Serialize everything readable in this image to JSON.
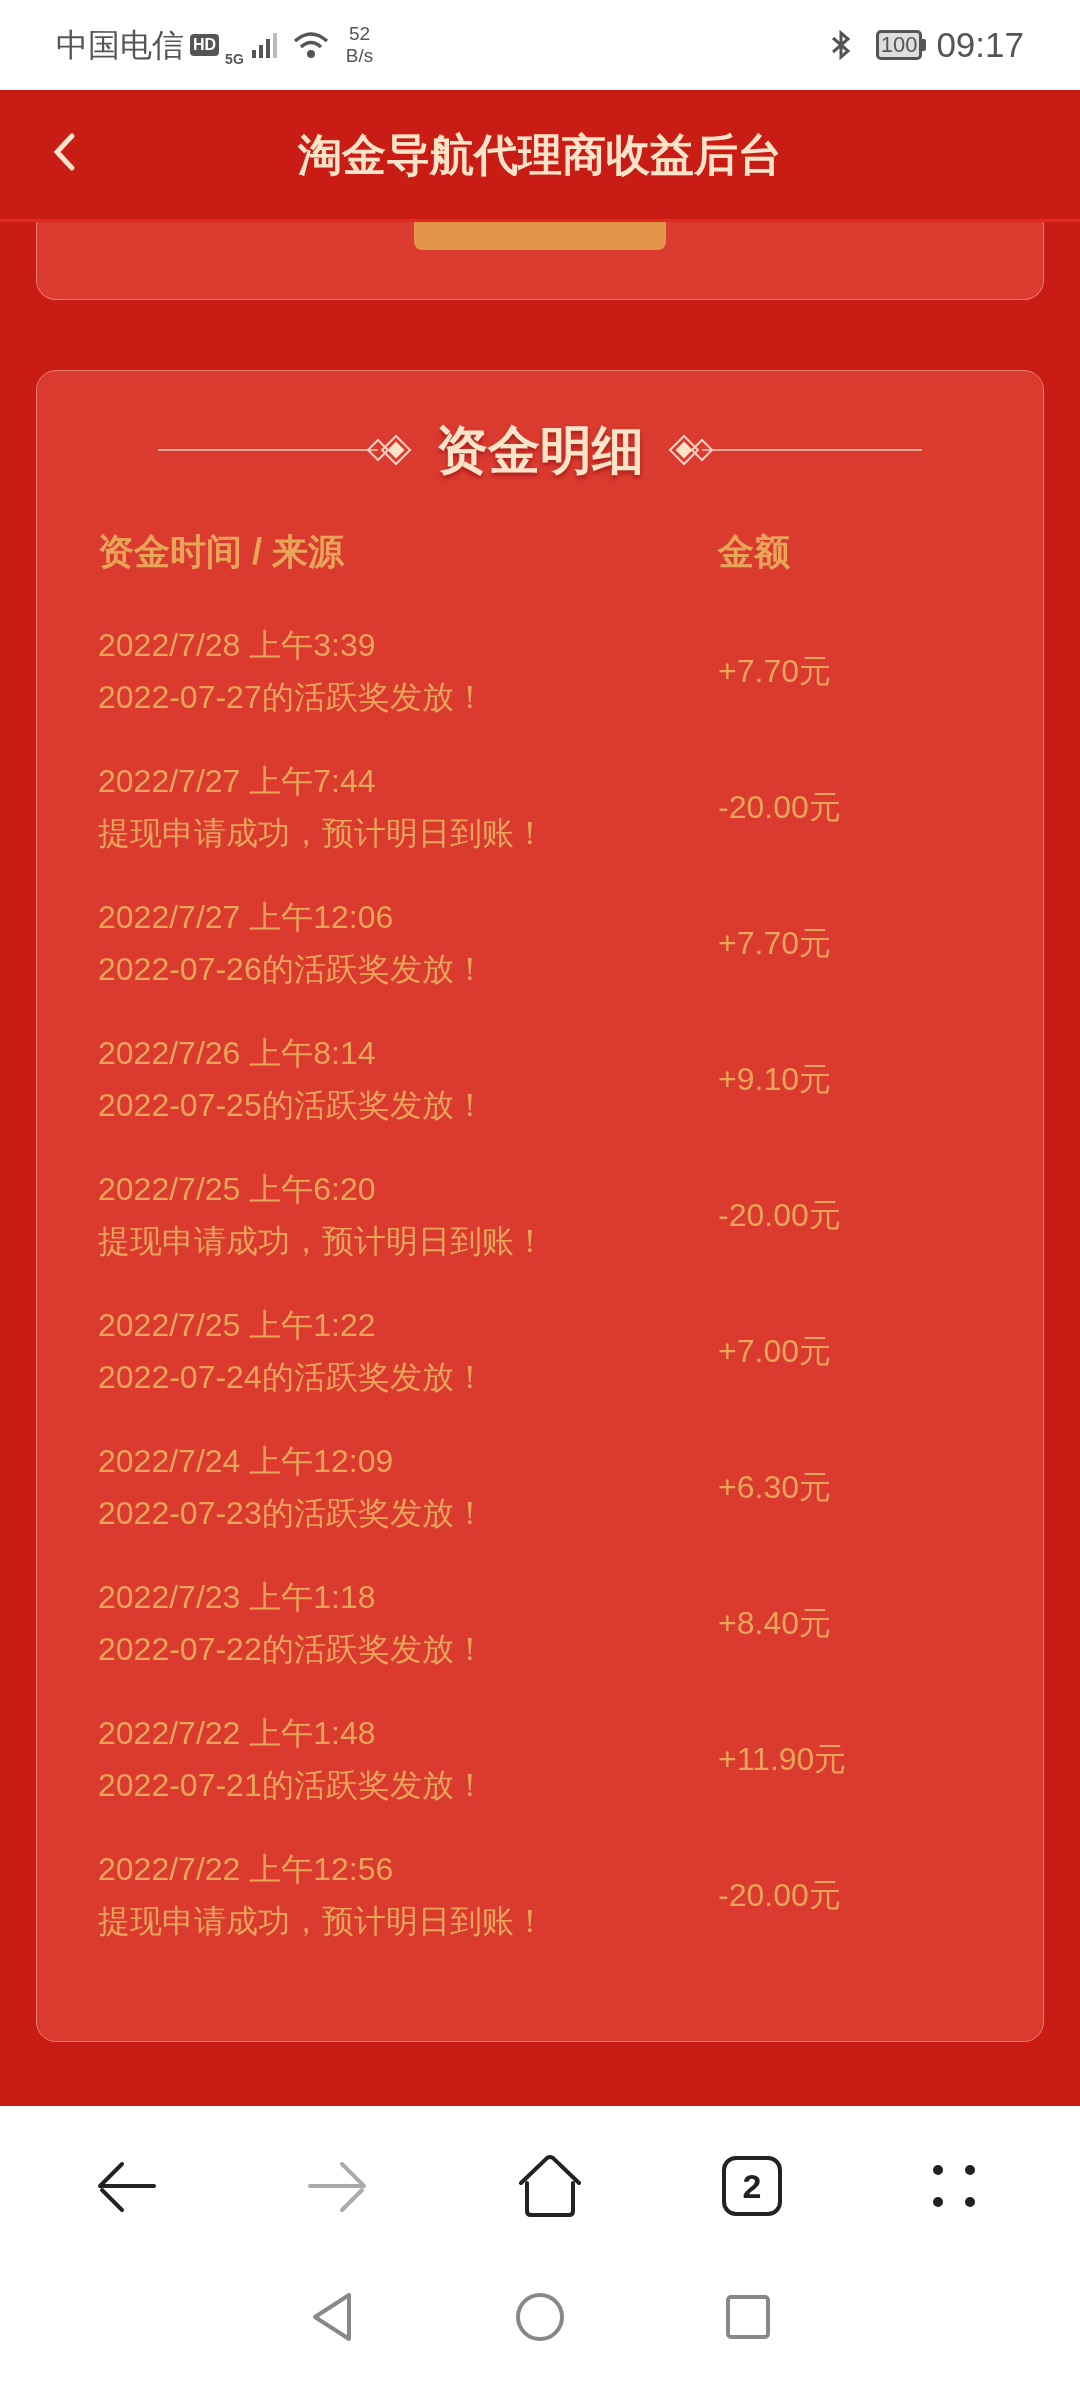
{
  "status_bar": {
    "carrier": "中国电信",
    "hd_badge": "HD",
    "network": "5G",
    "speed_value": "52",
    "speed_unit": "B/s",
    "battery": "100",
    "time": "09:17"
  },
  "header": {
    "title": "淘金导航代理商收益后台"
  },
  "funds": {
    "title": "资金明细",
    "columns": [
      "资金时间 / 来源",
      "金额"
    ],
    "rows": [
      {
        "time": "2022/7/28 上午3:39",
        "source": "2022-07-27的活跃奖发放！",
        "amount": "+7.70元"
      },
      {
        "time": "2022/7/27 上午7:44",
        "source": "提现申请成功，预计明日到账！",
        "amount": "-20.00元"
      },
      {
        "time": "2022/7/27 上午12:06",
        "source": "2022-07-26的活跃奖发放！",
        "amount": "+7.70元"
      },
      {
        "time": "2022/7/26 上午8:14",
        "source": "2022-07-25的活跃奖发放！",
        "amount": "+9.10元"
      },
      {
        "time": "2022/7/25 上午6:20",
        "source": "提现申请成功，预计明日到账！",
        "amount": "-20.00元"
      },
      {
        "time": "2022/7/25 上午1:22",
        "source": "2022-07-24的活跃奖发放！",
        "amount": "+7.00元"
      },
      {
        "time": "2022/7/24 上午12:09",
        "source": "2022-07-23的活跃奖发放！",
        "amount": "+6.30元"
      },
      {
        "time": "2022/7/23 上午1:18",
        "source": "2022-07-22的活跃奖发放！",
        "amount": "+8.40元"
      },
      {
        "time": "2022/7/22 上午1:48",
        "source": "2022-07-21的活跃奖发放！",
        "amount": "+11.90元"
      },
      {
        "time": "2022/7/22 上午12:56",
        "source": "提现申请成功，预计明日到账！",
        "amount": "-20.00元"
      }
    ]
  },
  "browser_bar": {
    "forward_disabled": true,
    "tab_count": "2"
  }
}
